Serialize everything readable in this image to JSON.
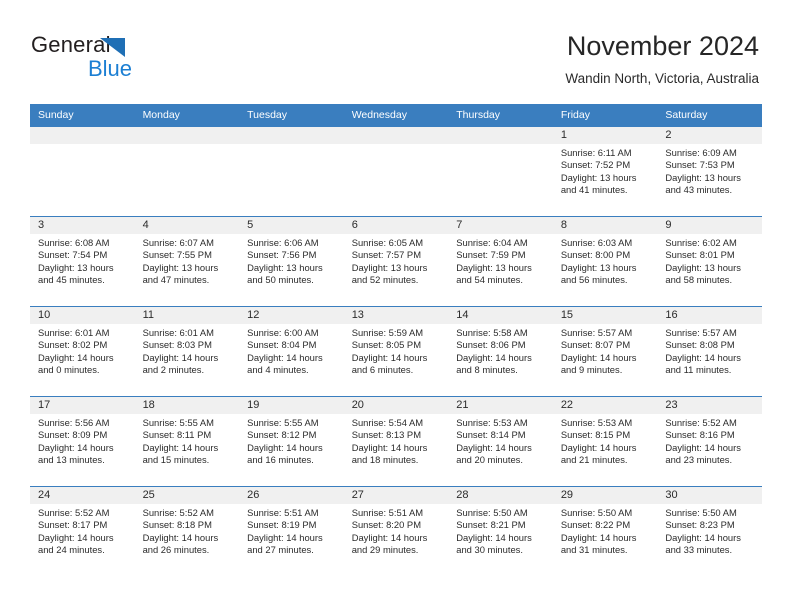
{
  "brand": {
    "name_part1": "General",
    "name_part2": "Blue",
    "triangle_color": "#1f6fb5",
    "blue_color": "#1c7fd3"
  },
  "header": {
    "month_title": "November 2024",
    "location": "Wandin North, Victoria, Australia",
    "header_bg": "#3a7ebf",
    "daynum_band_bg": "#f0f0f0"
  },
  "weekday_headers": [
    "Sunday",
    "Monday",
    "Tuesday",
    "Wednesday",
    "Thursday",
    "Friday",
    "Saturday"
  ],
  "weeks": [
    [
      {
        "day": "",
        "sunrise": "",
        "sunset": "",
        "daylight1": "",
        "daylight2": ""
      },
      {
        "day": "",
        "sunrise": "",
        "sunset": "",
        "daylight1": "",
        "daylight2": ""
      },
      {
        "day": "",
        "sunrise": "",
        "sunset": "",
        "daylight1": "",
        "daylight2": ""
      },
      {
        "day": "",
        "sunrise": "",
        "sunset": "",
        "daylight1": "",
        "daylight2": ""
      },
      {
        "day": "",
        "sunrise": "",
        "sunset": "",
        "daylight1": "",
        "daylight2": ""
      },
      {
        "day": "1",
        "sunrise": "Sunrise: 6:11 AM",
        "sunset": "Sunset: 7:52 PM",
        "daylight1": "Daylight: 13 hours",
        "daylight2": "and 41 minutes."
      },
      {
        "day": "2",
        "sunrise": "Sunrise: 6:09 AM",
        "sunset": "Sunset: 7:53 PM",
        "daylight1": "Daylight: 13 hours",
        "daylight2": "and 43 minutes."
      }
    ],
    [
      {
        "day": "3",
        "sunrise": "Sunrise: 6:08 AM",
        "sunset": "Sunset: 7:54 PM",
        "daylight1": "Daylight: 13 hours",
        "daylight2": "and 45 minutes."
      },
      {
        "day": "4",
        "sunrise": "Sunrise: 6:07 AM",
        "sunset": "Sunset: 7:55 PM",
        "daylight1": "Daylight: 13 hours",
        "daylight2": "and 47 minutes."
      },
      {
        "day": "5",
        "sunrise": "Sunrise: 6:06 AM",
        "sunset": "Sunset: 7:56 PM",
        "daylight1": "Daylight: 13 hours",
        "daylight2": "and 50 minutes."
      },
      {
        "day": "6",
        "sunrise": "Sunrise: 6:05 AM",
        "sunset": "Sunset: 7:57 PM",
        "daylight1": "Daylight: 13 hours",
        "daylight2": "and 52 minutes."
      },
      {
        "day": "7",
        "sunrise": "Sunrise: 6:04 AM",
        "sunset": "Sunset: 7:59 PM",
        "daylight1": "Daylight: 13 hours",
        "daylight2": "and 54 minutes."
      },
      {
        "day": "8",
        "sunrise": "Sunrise: 6:03 AM",
        "sunset": "Sunset: 8:00 PM",
        "daylight1": "Daylight: 13 hours",
        "daylight2": "and 56 minutes."
      },
      {
        "day": "9",
        "sunrise": "Sunrise: 6:02 AM",
        "sunset": "Sunset: 8:01 PM",
        "daylight1": "Daylight: 13 hours",
        "daylight2": "and 58 minutes."
      }
    ],
    [
      {
        "day": "10",
        "sunrise": "Sunrise: 6:01 AM",
        "sunset": "Sunset: 8:02 PM",
        "daylight1": "Daylight: 14 hours",
        "daylight2": "and 0 minutes."
      },
      {
        "day": "11",
        "sunrise": "Sunrise: 6:01 AM",
        "sunset": "Sunset: 8:03 PM",
        "daylight1": "Daylight: 14 hours",
        "daylight2": "and 2 minutes."
      },
      {
        "day": "12",
        "sunrise": "Sunrise: 6:00 AM",
        "sunset": "Sunset: 8:04 PM",
        "daylight1": "Daylight: 14 hours",
        "daylight2": "and 4 minutes."
      },
      {
        "day": "13",
        "sunrise": "Sunrise: 5:59 AM",
        "sunset": "Sunset: 8:05 PM",
        "daylight1": "Daylight: 14 hours",
        "daylight2": "and 6 minutes."
      },
      {
        "day": "14",
        "sunrise": "Sunrise: 5:58 AM",
        "sunset": "Sunset: 8:06 PM",
        "daylight1": "Daylight: 14 hours",
        "daylight2": "and 8 minutes."
      },
      {
        "day": "15",
        "sunrise": "Sunrise: 5:57 AM",
        "sunset": "Sunset: 8:07 PM",
        "daylight1": "Daylight: 14 hours",
        "daylight2": "and 9 minutes."
      },
      {
        "day": "16",
        "sunrise": "Sunrise: 5:57 AM",
        "sunset": "Sunset: 8:08 PM",
        "daylight1": "Daylight: 14 hours",
        "daylight2": "and 11 minutes."
      }
    ],
    [
      {
        "day": "17",
        "sunrise": "Sunrise: 5:56 AM",
        "sunset": "Sunset: 8:09 PM",
        "daylight1": "Daylight: 14 hours",
        "daylight2": "and 13 minutes."
      },
      {
        "day": "18",
        "sunrise": "Sunrise: 5:55 AM",
        "sunset": "Sunset: 8:11 PM",
        "daylight1": "Daylight: 14 hours",
        "daylight2": "and 15 minutes."
      },
      {
        "day": "19",
        "sunrise": "Sunrise: 5:55 AM",
        "sunset": "Sunset: 8:12 PM",
        "daylight1": "Daylight: 14 hours",
        "daylight2": "and 16 minutes."
      },
      {
        "day": "20",
        "sunrise": "Sunrise: 5:54 AM",
        "sunset": "Sunset: 8:13 PM",
        "daylight1": "Daylight: 14 hours",
        "daylight2": "and 18 minutes."
      },
      {
        "day": "21",
        "sunrise": "Sunrise: 5:53 AM",
        "sunset": "Sunset: 8:14 PM",
        "daylight1": "Daylight: 14 hours",
        "daylight2": "and 20 minutes."
      },
      {
        "day": "22",
        "sunrise": "Sunrise: 5:53 AM",
        "sunset": "Sunset: 8:15 PM",
        "daylight1": "Daylight: 14 hours",
        "daylight2": "and 21 minutes."
      },
      {
        "day": "23",
        "sunrise": "Sunrise: 5:52 AM",
        "sunset": "Sunset: 8:16 PM",
        "daylight1": "Daylight: 14 hours",
        "daylight2": "and 23 minutes."
      }
    ],
    [
      {
        "day": "24",
        "sunrise": "Sunrise: 5:52 AM",
        "sunset": "Sunset: 8:17 PM",
        "daylight1": "Daylight: 14 hours",
        "daylight2": "and 24 minutes."
      },
      {
        "day": "25",
        "sunrise": "Sunrise: 5:52 AM",
        "sunset": "Sunset: 8:18 PM",
        "daylight1": "Daylight: 14 hours",
        "daylight2": "and 26 minutes."
      },
      {
        "day": "26",
        "sunrise": "Sunrise: 5:51 AM",
        "sunset": "Sunset: 8:19 PM",
        "daylight1": "Daylight: 14 hours",
        "daylight2": "and 27 minutes."
      },
      {
        "day": "27",
        "sunrise": "Sunrise: 5:51 AM",
        "sunset": "Sunset: 8:20 PM",
        "daylight1": "Daylight: 14 hours",
        "daylight2": "and 29 minutes."
      },
      {
        "day": "28",
        "sunrise": "Sunrise: 5:50 AM",
        "sunset": "Sunset: 8:21 PM",
        "daylight1": "Daylight: 14 hours",
        "daylight2": "and 30 minutes."
      },
      {
        "day": "29",
        "sunrise": "Sunrise: 5:50 AM",
        "sunset": "Sunset: 8:22 PM",
        "daylight1": "Daylight: 14 hours",
        "daylight2": "and 31 minutes."
      },
      {
        "day": "30",
        "sunrise": "Sunrise: 5:50 AM",
        "sunset": "Sunset: 8:23 PM",
        "daylight1": "Daylight: 14 hours",
        "daylight2": "and 33 minutes."
      }
    ]
  ]
}
